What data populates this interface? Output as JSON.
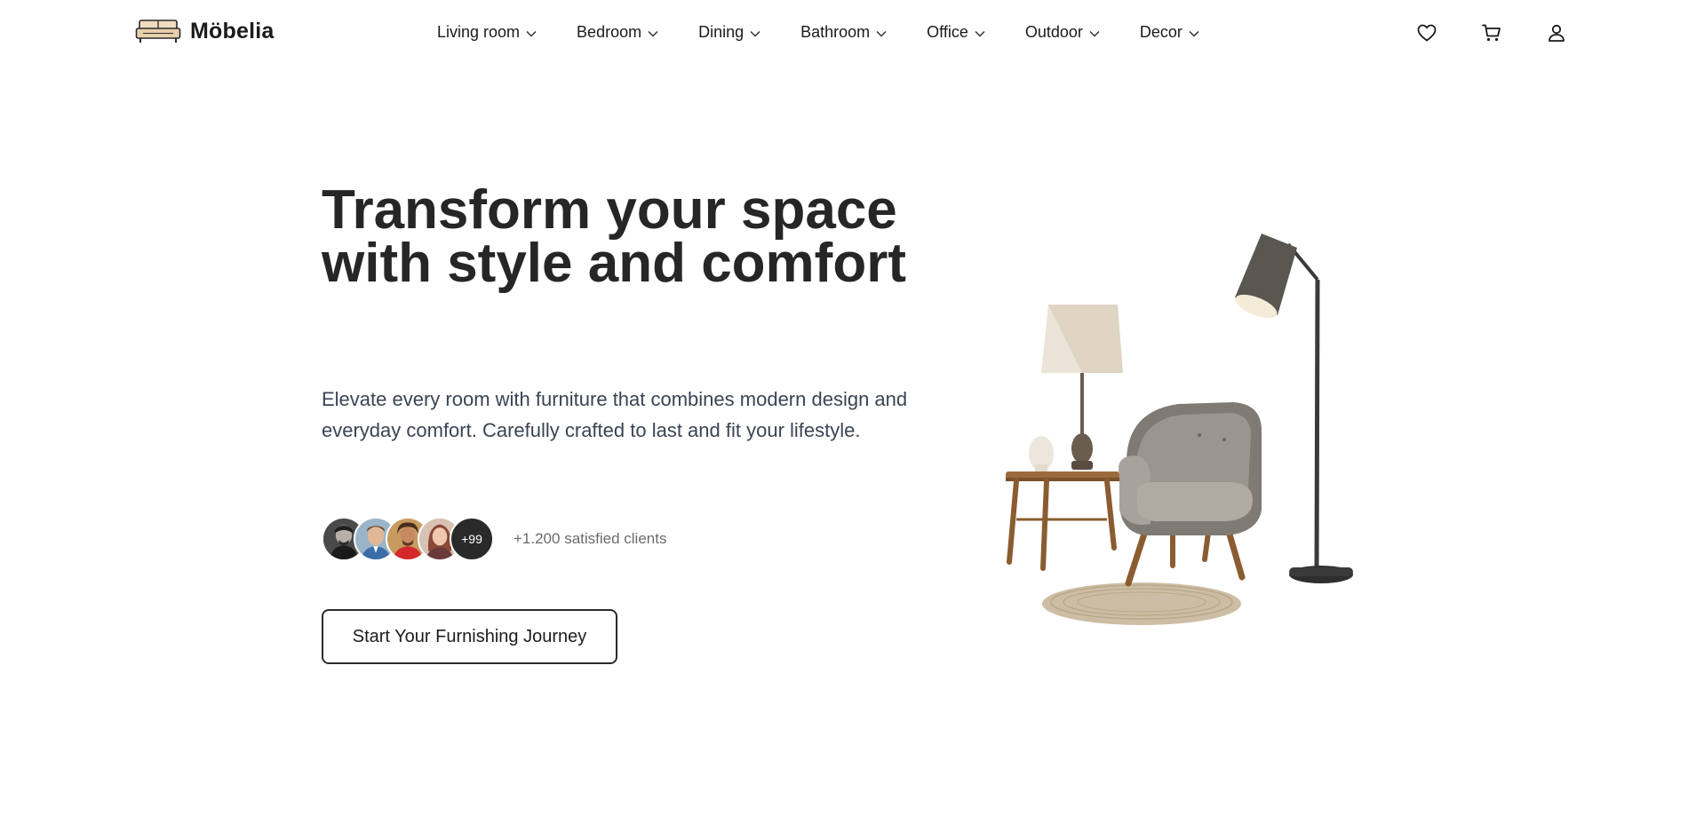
{
  "brand": {
    "name": "Möbelia",
    "logo_icon": "sofa-icon"
  },
  "nav": {
    "items": [
      {
        "label": "Living room"
      },
      {
        "label": "Bedroom"
      },
      {
        "label": "Dining"
      },
      {
        "label": "Bathroom"
      },
      {
        "label": "Office"
      },
      {
        "label": "Outdoor"
      },
      {
        "label": "Decor"
      }
    ],
    "dropdown_icon": "chevron-down-icon"
  },
  "header_actions": {
    "wishlist_icon": "heart-icon",
    "cart_icon": "cart-icon",
    "account_icon": "user-icon"
  },
  "hero": {
    "title": "Transform your space with style and comfort",
    "subtitle": "Elevate every room with furniture that combines modern design and everyday comfort. Carefully crafted to last and fit your lifestyle.",
    "clients_more": "+99",
    "clients_text": "+1.200 satisfied clients",
    "cta_label": "Start Your Furnishing Journey"
  },
  "colors": {
    "text_primary": "#262626",
    "text_body": "#3a4453",
    "text_muted": "#6b6b6b",
    "border": "#2b2b2b",
    "background": "#ffffff"
  }
}
